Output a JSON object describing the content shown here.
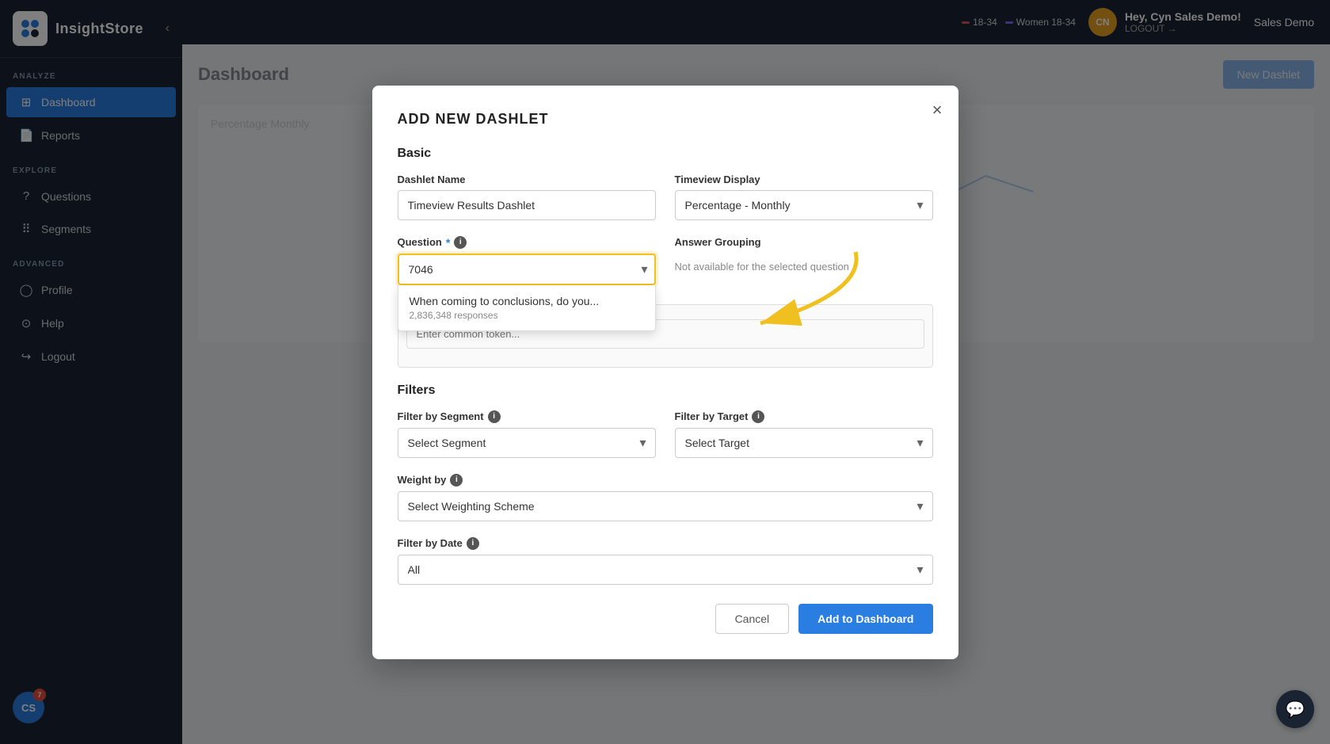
{
  "app": {
    "logo_text": "InsightStore",
    "logo_initials": "CS"
  },
  "sidebar": {
    "analyze_label": "ANALYZE",
    "explore_label": "EXPLORE",
    "advanced_label": "ADVANCED",
    "items": [
      {
        "id": "dashboard",
        "label": "Dashboard",
        "icon": "⊞",
        "active": true
      },
      {
        "id": "reports",
        "label": "Reports",
        "icon": "📄",
        "active": false
      },
      {
        "id": "questions",
        "label": "Questions",
        "icon": "❓",
        "active": false
      },
      {
        "id": "segments",
        "label": "Segments",
        "icon": "👥",
        "active": false
      },
      {
        "id": "profile",
        "label": "Profile",
        "icon": "👤",
        "active": false
      },
      {
        "id": "help",
        "label": "Help",
        "icon": "⊙",
        "active": false
      },
      {
        "id": "logout",
        "label": "Logout",
        "icon": "→",
        "active": false
      }
    ],
    "avatar_initials": "CS",
    "badge_count": "7"
  },
  "topbar": {
    "user_initials": "CN",
    "user_name": "Hey, Cyn Sales Demo!",
    "logout_label": "LOGOUT →",
    "org_label": "Sales Demo",
    "segments": [
      {
        "label": "18-34",
        "color": "#e05050"
      },
      {
        "label": "Women 18-34",
        "color": "#7b68ee"
      }
    ]
  },
  "background": {
    "title": "Dashboard",
    "new_dashlet_label": "New Dashlet",
    "percentage_monthly_label": "Percentage Monthly"
  },
  "modal": {
    "title": "ADD NEW DASHLET",
    "close_label": "×",
    "basic_section": "Basic",
    "dashlet_name_label": "Dashlet Name",
    "dashlet_name_value": "Timeview Results Dashlet",
    "timeview_display_label": "Timeview Display",
    "timeview_display_value": "Percentage - Monthly",
    "question_label": "Question",
    "question_value": "7046",
    "question_placeholder": "7046",
    "answer_grouping_label": "Answer Grouping",
    "answer_grouping_text": "Not available for the selected question",
    "common_token_placeholder": "Enter common token...",
    "dropdown_item_title": "When coming to conclusions, do you...",
    "dropdown_item_meta": "2,836,348 responses",
    "filters_section": "Filters",
    "filter_segment_label": "Filter by Segment",
    "filter_segment_placeholder": "Select Segment",
    "filter_target_label": "Filter by Target",
    "filter_target_placeholder": "Select Target",
    "weight_by_label": "Weight by",
    "weight_by_placeholder": "Select Weighting Scheme",
    "filter_date_label": "Filter by Date",
    "filter_date_value": "All",
    "cancel_label": "Cancel",
    "add_label": "Add to Dashboard"
  }
}
